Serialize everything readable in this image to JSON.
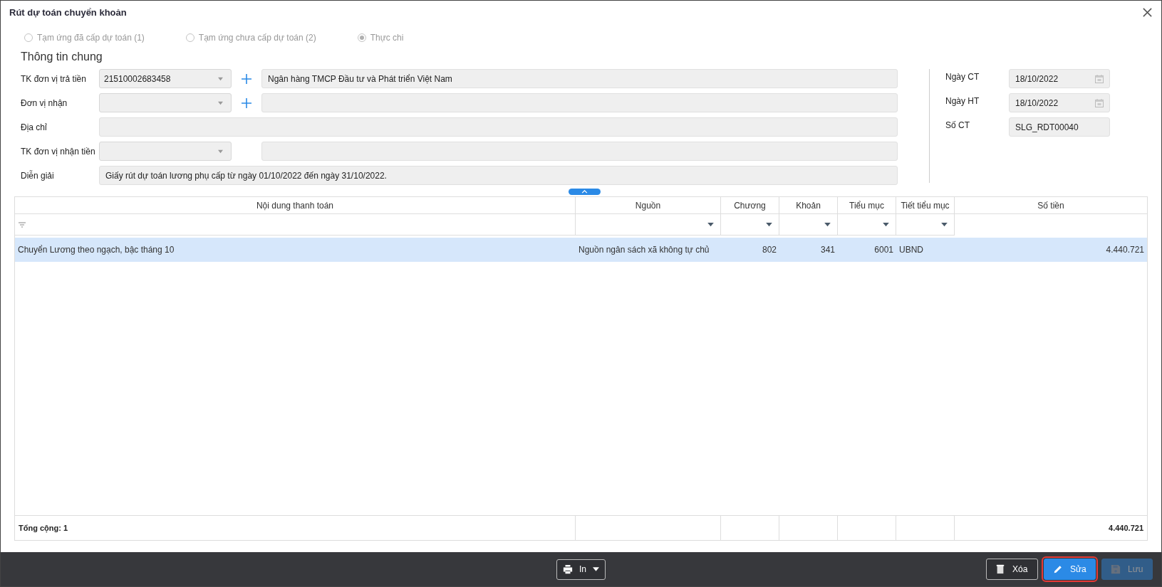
{
  "window": {
    "title": "Rút dự toán chuyển khoản"
  },
  "radios": [
    {
      "label": "Tạm ứng đã cấp dự toán (1)",
      "selected": false,
      "disabled": true
    },
    {
      "label": "Tạm ứng chưa cấp dự toán (2)",
      "selected": false,
      "disabled": true
    },
    {
      "label": "Thực chi",
      "selected": true,
      "disabled": true
    }
  ],
  "section_title": "Thông tin chung",
  "left_fields": [
    {
      "label": "TK đơn vị trả tiền",
      "kind": "combo",
      "combo_value": "21510002683458",
      "add": true,
      "text_value": "Ngân hàng TMCP Đầu tư và Phát triển Việt Nam"
    },
    {
      "label": "Đơn vị nhận",
      "kind": "combo",
      "add": true
    },
    {
      "label": "Địa chỉ",
      "kind": "text"
    },
    {
      "label": "TK đơn vị nhận tiền",
      "kind": "combo",
      "add": false
    },
    {
      "label": "Diễn giải",
      "kind": "text",
      "value": "Giấy rút dự toán lương phụ cấp từ ngày 01/10/2022 đến ngày 31/10/2022."
    }
  ],
  "right_fields": [
    {
      "label": "Ngày CT",
      "kind": "date",
      "value": "18/10/2022"
    },
    {
      "label": "Ngày HT",
      "kind": "date",
      "value": "18/10/2022"
    },
    {
      "label": "Số CT",
      "kind": "text",
      "value": "SLG_RDT00040"
    }
  ],
  "table": {
    "columns": [
      {
        "title": "Nội dung thanh toán",
        "kind": "search"
      },
      {
        "title": "Nguồn",
        "kind": "dropdown"
      },
      {
        "title": "Chương",
        "kind": "dropdown"
      },
      {
        "title": "Khoản",
        "kind": "dropdown"
      },
      {
        "title": "Tiểu mục",
        "kind": "dropdown"
      },
      {
        "title": "Tiết tiểu mục",
        "kind": "dropdown"
      },
      {
        "title": "Số tiền",
        "kind": "plain"
      }
    ],
    "rows": [
      {
        "selected": true,
        "cells": [
          "Chuyển Lương theo ngạch, bậc tháng 10",
          "Nguồn ngân sách xã không tự chủ",
          "802",
          "341",
          "6001",
          "UBND",
          "4.440.721"
        ]
      }
    ],
    "footer": {
      "label": "Tổng cộng: 1",
      "amount": "4.440.721"
    }
  },
  "buttons": [
    {
      "label": "In",
      "kind": "print",
      "disabled": false,
      "focused": false
    },
    {
      "label": "Xóa",
      "kind": "delete",
      "disabled": false,
      "focused": false
    },
    {
      "label": "Sửa",
      "kind": "edit",
      "disabled": false,
      "focused": true
    },
    {
      "label": "Lưu",
      "kind": "save",
      "disabled": true,
      "focused": false
    }
  ]
}
